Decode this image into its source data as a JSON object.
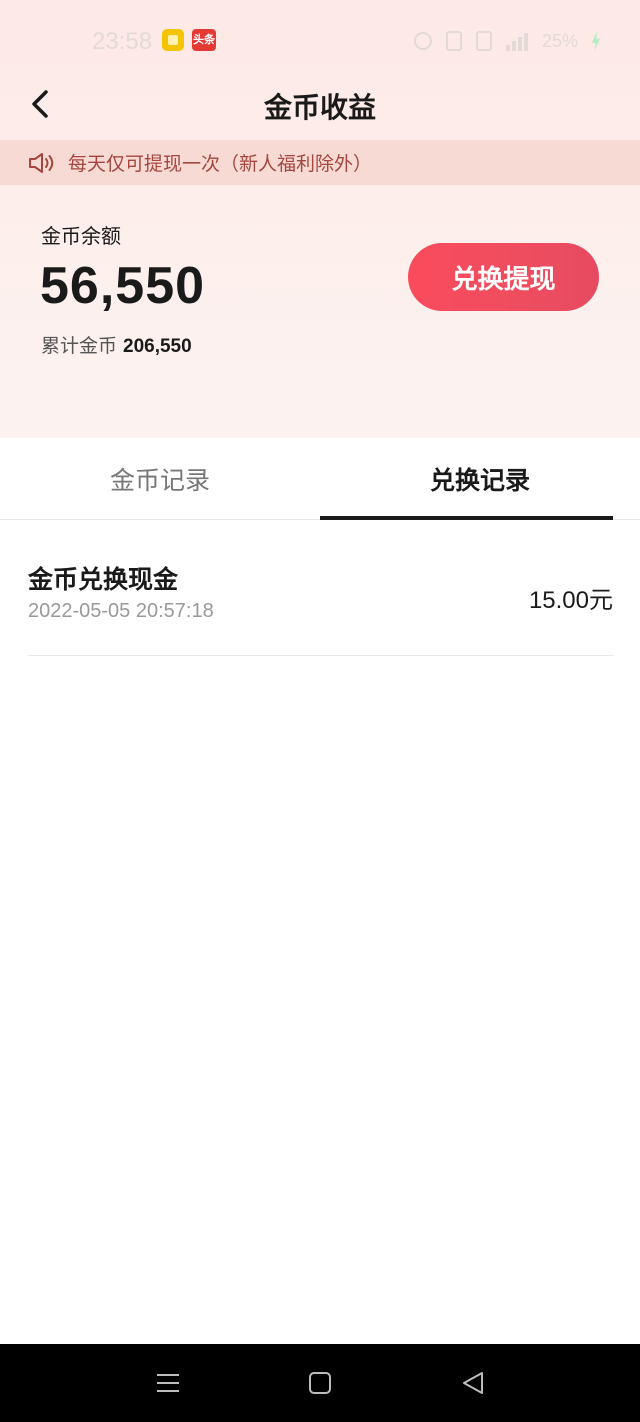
{
  "status_bar": {
    "time": "23:58",
    "notif_b_label": "头条",
    "battery": "25%"
  },
  "header": {
    "title": "金币收益"
  },
  "notice": {
    "text": "每天仅可提现一次（新人福利除外）"
  },
  "balance": {
    "label": "金币余额",
    "value": "56,550",
    "total_label": "累计金币",
    "total_value": "206,550"
  },
  "actions": {
    "withdraw_label": "兑换提现"
  },
  "tabs": [
    {
      "label": "金币记录",
      "active": false
    },
    {
      "label": "兑换记录",
      "active": true
    }
  ],
  "records": [
    {
      "title": "金币兑换现金",
      "time": "2022-05-05 20:57:18",
      "amount": "15.00元"
    }
  ],
  "colors": {
    "accent": "#ee4d5f",
    "notice_text": "#a5473e",
    "notice_bg": "#f8dad5",
    "header_bg": "#fde9e6"
  }
}
